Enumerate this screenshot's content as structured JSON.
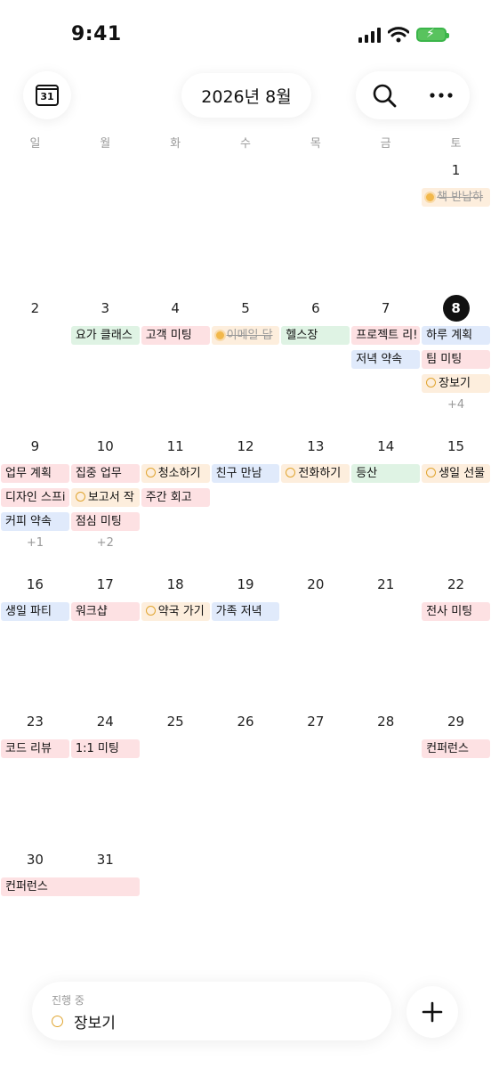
{
  "status": {
    "time": "9:41"
  },
  "header": {
    "calendar_icon_day": "31",
    "title": "2026년 8월"
  },
  "weekdays": [
    "일",
    "월",
    "화",
    "수",
    "목",
    "금",
    "토"
  ],
  "days": [
    {
      "d": "1",
      "col": 6,
      "row": 0
    },
    {
      "d": "2",
      "col": 0,
      "row": 1
    },
    {
      "d": "3",
      "col": 1,
      "row": 1
    },
    {
      "d": "4",
      "col": 2,
      "row": 1
    },
    {
      "d": "5",
      "col": 3,
      "row": 1
    },
    {
      "d": "6",
      "col": 4,
      "row": 1
    },
    {
      "d": "7",
      "col": 5,
      "row": 1
    },
    {
      "d": "8",
      "col": 6,
      "row": 1,
      "today": true
    },
    {
      "d": "9",
      "col": 0,
      "row": 2
    },
    {
      "d": "10",
      "col": 1,
      "row": 2
    },
    {
      "d": "11",
      "col": 2,
      "row": 2
    },
    {
      "d": "12",
      "col": 3,
      "row": 2
    },
    {
      "d": "13",
      "col": 4,
      "row": 2
    },
    {
      "d": "14",
      "col": 5,
      "row": 2
    },
    {
      "d": "15",
      "col": 6,
      "row": 2
    },
    {
      "d": "16",
      "col": 0,
      "row": 3
    },
    {
      "d": "17",
      "col": 1,
      "row": 3
    },
    {
      "d": "18",
      "col": 2,
      "row": 3
    },
    {
      "d": "19",
      "col": 3,
      "row": 3
    },
    {
      "d": "20",
      "col": 4,
      "row": 3
    },
    {
      "d": "21",
      "col": 5,
      "row": 3
    },
    {
      "d": "22",
      "col": 6,
      "row": 3
    },
    {
      "d": "23",
      "col": 0,
      "row": 4
    },
    {
      "d": "24",
      "col": 1,
      "row": 4
    },
    {
      "d": "25",
      "col": 2,
      "row": 4
    },
    {
      "d": "26",
      "col": 3,
      "row": 4
    },
    {
      "d": "27",
      "col": 4,
      "row": 4
    },
    {
      "d": "28",
      "col": 5,
      "row": 4
    },
    {
      "d": "29",
      "col": 6,
      "row": 4
    },
    {
      "d": "30",
      "col": 0,
      "row": 5
    },
    {
      "d": "31",
      "col": 1,
      "row": 5
    }
  ],
  "events": [
    {
      "title": "책 반납하",
      "col": 6,
      "row": 0,
      "slot": 0,
      "span": 1,
      "color": "orange",
      "icon": "sun",
      "done": true
    },
    {
      "title": "요가 클래스",
      "col": 1,
      "row": 1,
      "slot": 0,
      "span": 1,
      "color": "green"
    },
    {
      "title": "고객 미팅",
      "col": 2,
      "row": 1,
      "slot": 0,
      "span": 1,
      "color": "pink"
    },
    {
      "title": "이메일 답",
      "col": 3,
      "row": 1,
      "slot": 0,
      "span": 1,
      "color": "orange",
      "icon": "sun",
      "done": true
    },
    {
      "title": "헬스장",
      "col": 4,
      "row": 1,
      "slot": 0,
      "span": 1,
      "color": "green"
    },
    {
      "title": "프로젝트 리!",
      "col": 5,
      "row": 1,
      "slot": 0,
      "span": 1,
      "color": "pink"
    },
    {
      "title": "하루 계획",
      "col": 6,
      "row": 1,
      "slot": 0,
      "span": 1,
      "color": "blue"
    },
    {
      "title": "저녁 약속",
      "col": 5,
      "row": 1,
      "slot": 1,
      "span": 1,
      "color": "blue"
    },
    {
      "title": "팀 미팅",
      "col": 6,
      "row": 1,
      "slot": 1,
      "span": 1,
      "color": "pink"
    },
    {
      "title": "장보기",
      "col": 6,
      "row": 1,
      "slot": 2,
      "span": 1,
      "color": "orange",
      "icon": "circle"
    },
    {
      "title": "업무 계획",
      "col": 0,
      "row": 2,
      "slot": 0,
      "span": 1,
      "color": "pink"
    },
    {
      "title": "집중 업무",
      "col": 1,
      "row": 2,
      "slot": 0,
      "span": 1,
      "color": "pink"
    },
    {
      "title": "청소하기",
      "col": 2,
      "row": 2,
      "slot": 0,
      "span": 1,
      "color": "orange",
      "icon": "circle"
    },
    {
      "title": "친구 만남",
      "col": 3,
      "row": 2,
      "slot": 0,
      "span": 1,
      "color": "blue"
    },
    {
      "title": "전화하기",
      "col": 4,
      "row": 2,
      "slot": 0,
      "span": 1,
      "color": "orange",
      "icon": "circle"
    },
    {
      "title": "등산",
      "col": 5,
      "row": 2,
      "slot": 0,
      "span": 1,
      "color": "green"
    },
    {
      "title": "생일 선물",
      "col": 6,
      "row": 2,
      "slot": 0,
      "span": 1,
      "color": "orange",
      "icon": "circle"
    },
    {
      "title": "디자인 스프i",
      "col": 0,
      "row": 2,
      "slot": 1,
      "span": 1,
      "color": "pink"
    },
    {
      "title": "보고서 작",
      "col": 1,
      "row": 2,
      "slot": 1,
      "span": 1,
      "color": "orange",
      "icon": "circle"
    },
    {
      "title": "주간 회고",
      "col": 2,
      "row": 2,
      "slot": 1,
      "span": 1,
      "color": "pink"
    },
    {
      "title": "커피 약속",
      "col": 0,
      "row": 2,
      "slot": 2,
      "span": 1,
      "color": "blue"
    },
    {
      "title": "점심 미팅",
      "col": 1,
      "row": 2,
      "slot": 2,
      "span": 1,
      "color": "pink"
    },
    {
      "title": "생일 파티",
      "col": 0,
      "row": 3,
      "slot": 0,
      "span": 1,
      "color": "blue"
    },
    {
      "title": "워크샵",
      "col": 1,
      "row": 3,
      "slot": 0,
      "span": 1,
      "color": "pink"
    },
    {
      "title": "약국 가기",
      "col": 2,
      "row": 3,
      "slot": 0,
      "span": 1,
      "color": "orange",
      "icon": "circle"
    },
    {
      "title": "가족 저녁",
      "col": 3,
      "row": 3,
      "slot": 0,
      "span": 1,
      "color": "blue"
    },
    {
      "title": "전사 미팅",
      "col": 6,
      "row": 3,
      "slot": 0,
      "span": 1,
      "color": "pink"
    },
    {
      "title": "코드 리뷰",
      "col": 0,
      "row": 4,
      "slot": 0,
      "span": 1,
      "color": "pink"
    },
    {
      "title": "1:1 미팅",
      "col": 1,
      "row": 4,
      "slot": 0,
      "span": 1,
      "color": "pink"
    },
    {
      "title": "컨퍼런스",
      "col": 6,
      "row": 4,
      "slot": 0,
      "span": 1,
      "color": "pink"
    },
    {
      "title": "컨퍼런스",
      "col": 0,
      "row": 5,
      "slot": 0,
      "span": 2,
      "color": "pink"
    }
  ],
  "more": [
    {
      "text": "+4",
      "col": 6,
      "row": 1
    },
    {
      "text": "+1",
      "col": 0,
      "row": 2
    },
    {
      "text": "+2",
      "col": 1,
      "row": 2
    }
  ],
  "bottom": {
    "label": "진행 중",
    "task": "장보기"
  }
}
